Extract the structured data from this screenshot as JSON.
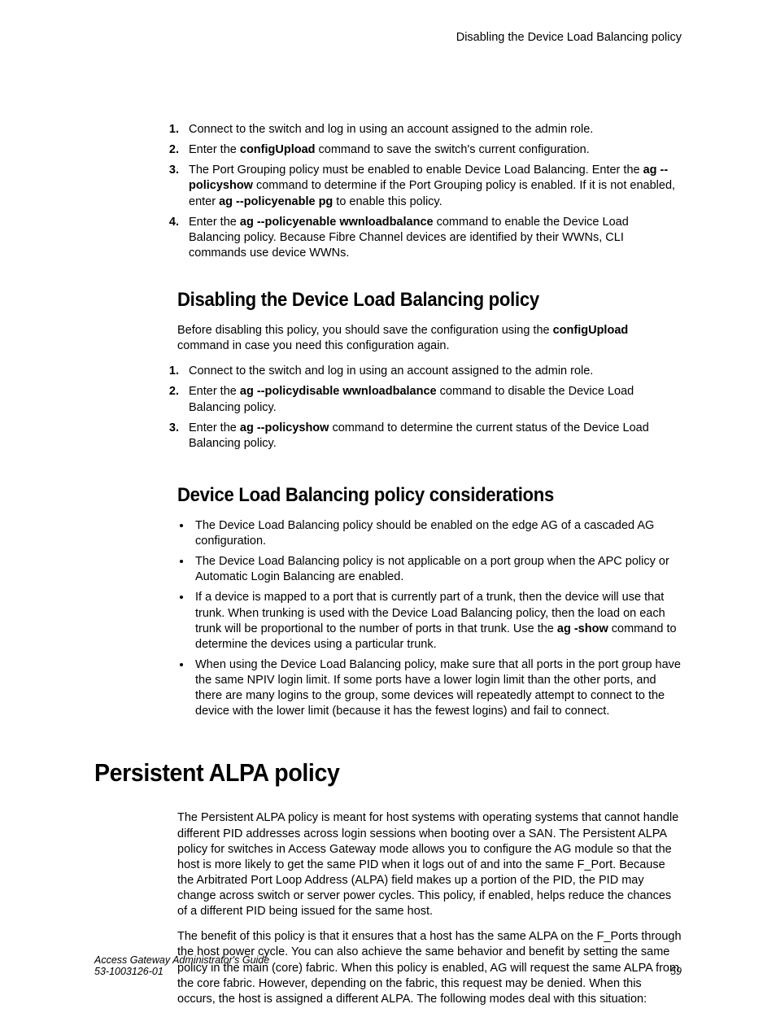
{
  "runner": "Disabling the Device Load Balancing policy",
  "steps1": {
    "s1": "Connect to the switch and log in using an account assigned to the admin role.",
    "s2a": "Enter the ",
    "s2b": "configUpload",
    "s2c": " command to save the switch's current configuration.",
    "s3a": "The Port Grouping policy must be enabled to enable Device Load Balancing. Enter the ",
    "s3b": "ag --policyshow",
    "s3c": " command to determine if the Port Grouping policy is enabled. If it is not enabled, enter ",
    "s3d": "ag --policyenable pg",
    "s3e": " to enable this policy.",
    "s4a": "Enter the ",
    "s4b": "ag --policyenable wwnloadbalance",
    "s4c": " command to enable the Device Load Balancing policy. Because Fibre Channel devices are identified by their WWNs, CLI commands use device WWNs."
  },
  "h_disable": "Disabling the Device Load Balancing policy",
  "disable_intro_a": "Before disabling this policy, you should save the configuration using the ",
  "disable_intro_b": "configUpload",
  "disable_intro_c": " command in case you need this configuration again.",
  "steps2": {
    "s1": "Connect to the switch and log in using an account assigned to the admin role.",
    "s2a": "Enter the ",
    "s2b": "ag --policydisable wwnloadbalance",
    "s2c": " command to disable the Device Load Balancing policy.",
    "s3a": "Enter the ",
    "s3b": "ag --policyshow",
    "s3c": " command to determine the current status of the Device Load Balancing policy."
  },
  "h_consider": "Device Load Balancing policy considerations",
  "bullets": {
    "b1": "The Device Load Balancing policy should be enabled on the edge AG of a cascaded AG configuration.",
    "b2": "The Device Load Balancing policy is not applicable on a port group when the APC policy or Automatic Login Balancing are enabled.",
    "b3a": "If a device is mapped to a port that is currently part of a trunk, then the device will use that trunk. When trunking is used with the Device Load Balancing policy, then the load on each trunk will be proportional to the number of ports in that trunk. Use the ",
    "b3b": "ag -show",
    "b3c": " command to determine the devices using a particular trunk.",
    "b4": "When using the Device Load Balancing policy, make sure that all ports in the port group have the same NPIV login limit. If some ports have a lower login limit than the other ports, and there are many logins to the group, some devices will repeatedly attempt to connect to the device with the lower limit (because it has the fewest logins) and fail to connect."
  },
  "h_alpa": "Persistent ALPA policy",
  "alpa_p1": "The Persistent ALPA policy is meant for host systems with operating systems that cannot handle different PID addresses across login sessions when booting over a SAN. The Persistent ALPA policy for switches in Access Gateway mode allows you to configure the AG module so that the host is more likely to get the same PID when it logs out of and into the same F_Port. Because the Arbitrated Port Loop Address (ALPA) field makes up a portion of the PID, the PID may change across switch or server power cycles. This policy, if enabled, helps reduce the chances of a different PID being issued for the same host.",
  "alpa_p2": "The benefit of this policy is that it ensures that a host has the same ALPA on the F_Ports through the host power cycle. You can also achieve the same behavior and benefit by setting the same policy in the main (core) fabric. When this policy is enabled, AG will request the same ALPA from the core fabric. However, depending on the fabric, this request may be denied. When this occurs, the host is assigned a different ALPA. The following modes deal with this situation:",
  "footer": {
    "title": "Access Gateway Administrator's Guide",
    "docnum": "53-1003126-01",
    "page": "59"
  }
}
